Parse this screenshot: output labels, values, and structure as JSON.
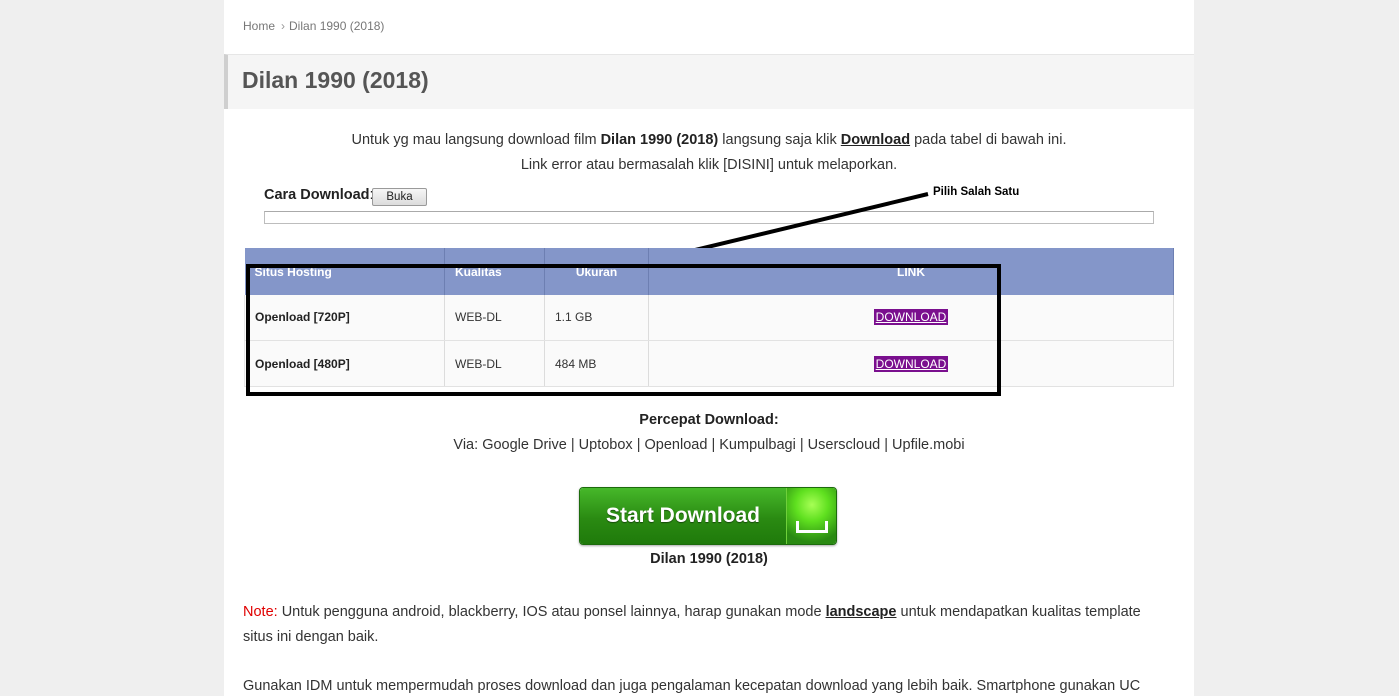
{
  "breadcrumb": {
    "home": "Home",
    "separator": "›",
    "current": "Dilan 1990 (2018)"
  },
  "title": "Dilan 1990 (2018)",
  "intro": {
    "line1_prefix": "Untuk yg mau langsung download film",
    "film": "Dilan 1990 (2018)",
    "line1_mid": "langsung saja klik",
    "download_link": "Download",
    "line1_suffix": "pada tabel di bawah ini.",
    "line2": "Link error atau bermasalah klik [DISINI] untuk melaporkan."
  },
  "cara_download": {
    "label": "Cara Download",
    "colon": ":",
    "button": "Buka"
  },
  "annotation": {
    "label": "Pilih Salah Satu"
  },
  "table": {
    "headers": [
      "Situs Hosting",
      "Kualitas",
      "Ukuran",
      "LINK"
    ],
    "rows": [
      {
        "host": "Openload [720P]",
        "quality": "WEB-DL",
        "size": "1.1 GB",
        "link": "DOWNLOAD"
      },
      {
        "host": "Openload [480P]",
        "quality": "WEB-DL",
        "size": "484 MB",
        "link": "DOWNLOAD"
      }
    ]
  },
  "percepat": {
    "title": "Percepat Download:",
    "prefix": "Via:",
    "links": [
      "Google Drive",
      "Uptobox",
      "Openload",
      "Kumpulbagi",
      "Userscloud",
      "Upfile.mobi"
    ],
    "separator": "|"
  },
  "start_download": {
    "label": "Start Download",
    "caption": "Dilan 1990 (2018)"
  },
  "note": {
    "label": "Note:",
    "text_before": "Untuk pengguna android, blackberry, IOS atau ponsel lainnya, harap gunakan mode",
    "link": "landscape",
    "text_after": "untuk mendapatkan kualitas template situs ini dengan baik."
  },
  "idm_text": "Gunakan IDM untuk mempermudah proses download dan juga pengalaman kecepatan download yang lebih baik. Smartphone gunakan UC",
  "colors": {
    "table_header": "#8496c9",
    "download_button": "#7a0f8e",
    "start_button_green": "#2a8a12",
    "note_red": "#e00000"
  }
}
